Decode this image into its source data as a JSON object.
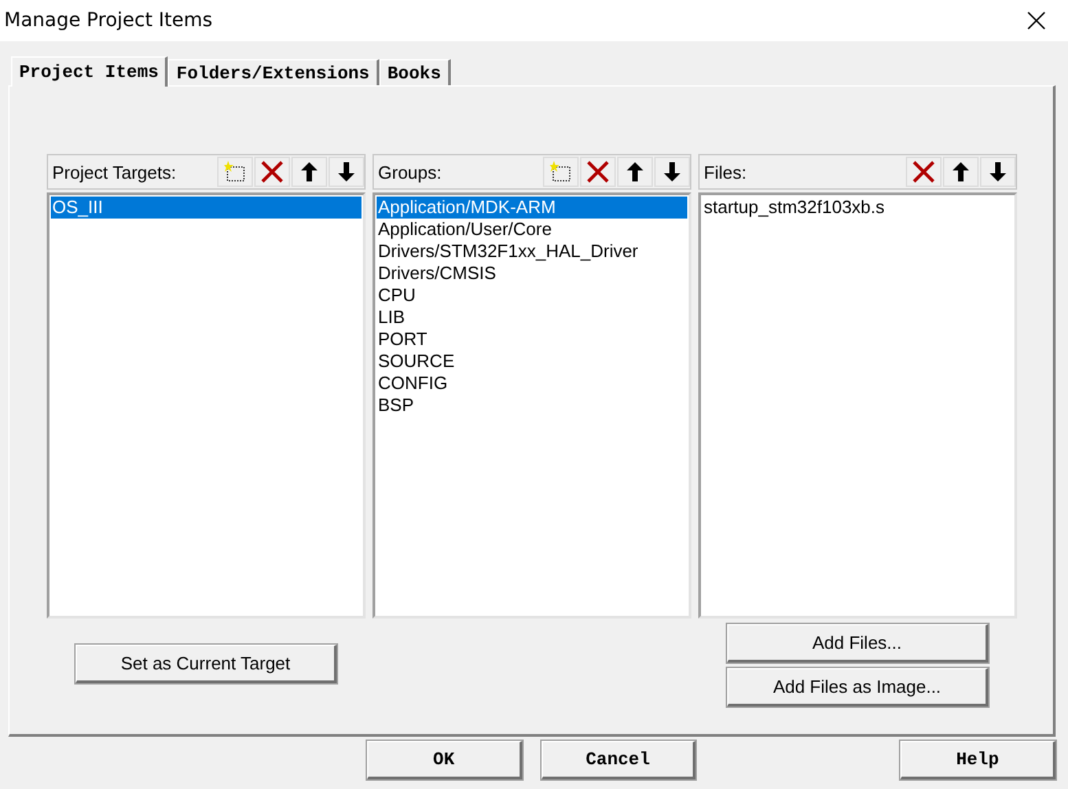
{
  "window": {
    "title": "Manage Project Items"
  },
  "tabs": [
    {
      "label": "Project Items",
      "selected": true
    },
    {
      "label": "Folders/Extensions",
      "selected": false
    },
    {
      "label": "Books",
      "selected": false
    }
  ],
  "panels": [
    {
      "label": "Project Targets:",
      "tools": [
        {
          "kind": "new"
        },
        {
          "kind": "delete"
        },
        {
          "kind": "up"
        },
        {
          "kind": "down"
        }
      ],
      "items": [
        {
          "label": "OS_III",
          "selected": true
        }
      ],
      "buttons": [
        "Set as Current Target"
      ]
    },
    {
      "label": "Groups:",
      "tools": [
        {
          "kind": "new"
        },
        {
          "kind": "delete"
        },
        {
          "kind": "up"
        },
        {
          "kind": "down"
        }
      ],
      "items": [
        {
          "label": "Application/MDK-ARM",
          "selected": true
        },
        {
          "label": "Application/User/Core",
          "selected": false
        },
        {
          "label": "Drivers/STM32F1xx_HAL_Driver",
          "selected": false
        },
        {
          "label": "Drivers/CMSIS",
          "selected": false
        },
        {
          "label": "CPU",
          "selected": false
        },
        {
          "label": "LIB",
          "selected": false
        },
        {
          "label": "PORT",
          "selected": false
        },
        {
          "label": "SOURCE",
          "selected": false
        },
        {
          "label": "CONFIG",
          "selected": false
        },
        {
          "label": "BSP",
          "selected": false
        }
      ]
    },
    {
      "label": "Files:",
      "tools": [
        {
          "kind": "delete"
        },
        {
          "kind": "up"
        },
        {
          "kind": "down"
        }
      ],
      "items": [
        {
          "label": "startup_stm32f103xb.s",
          "selected": false
        }
      ],
      "buttons": [
        "Add Files...",
        "Add Files as Image..."
      ]
    }
  ],
  "dialog_buttons": [
    "OK",
    "Cancel",
    "Help"
  ]
}
